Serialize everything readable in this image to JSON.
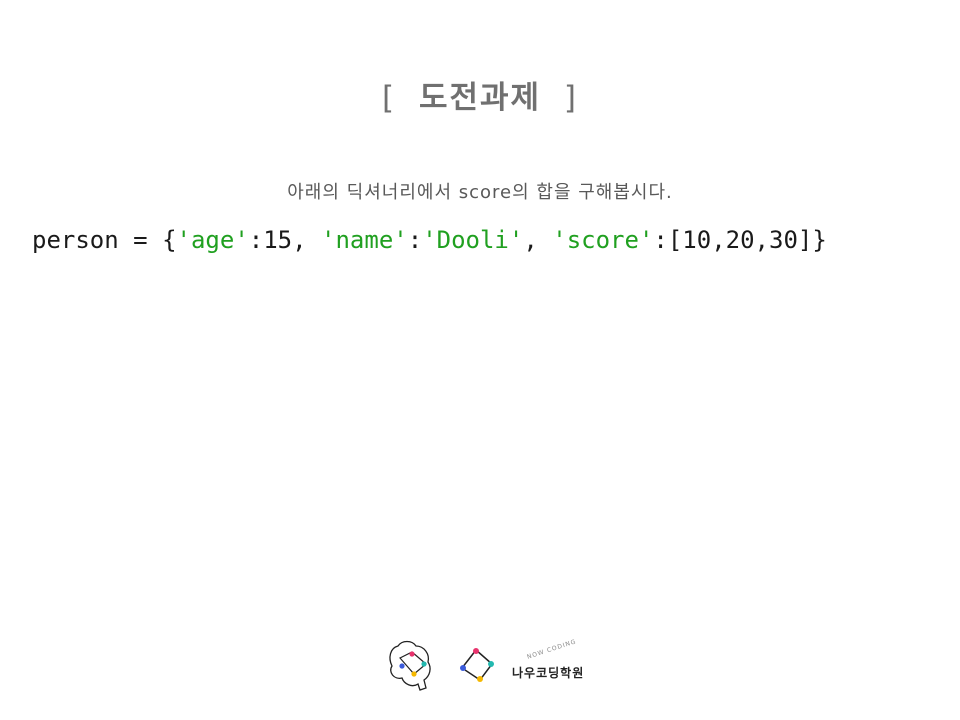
{
  "slide": {
    "title_open": "[",
    "title": "도전과제",
    "title_close": "]",
    "instruction": "아래의 딕셔너리에서 score의 합을 구해봅시다."
  },
  "code": {
    "var": "person",
    "eq": " = ",
    "open_brace": "{",
    "key_age": "'age'",
    "colon1": ":",
    "val_age": "15",
    "sep1": ", ",
    "key_name": "'name'",
    "colon2": ":",
    "val_name": "'Dooli'",
    "sep2": ", ",
    "key_score": "'score'",
    "colon3": ":",
    "val_score": "[10,20,30]",
    "close_brace": "}"
  },
  "footer": {
    "logo_name": "나우코딩학원",
    "logo_arc": "NOW CODING",
    "icons": [
      "brain-logo-icon",
      "diamond-logo-icon"
    ],
    "colors": {
      "pink": "#e8336d",
      "teal": "#23b9b0",
      "blue": "#3b5bdb",
      "yellow": "#f5b800"
    }
  }
}
